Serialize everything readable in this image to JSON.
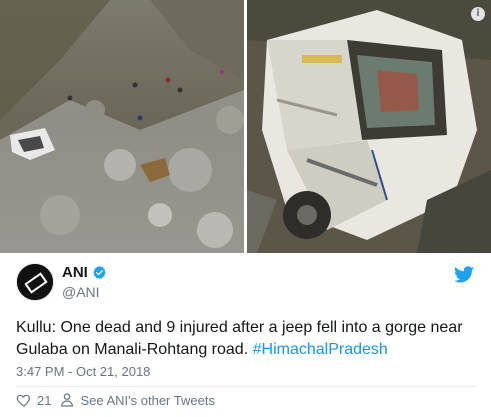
{
  "tweet": {
    "author": {
      "display_name": "ANI",
      "handle": "@ANI",
      "avatar_text": "ANI",
      "verified_icon": "verified-badge-icon"
    },
    "text_main": "Kullu: One dead and 9 injured after a jeep fell into a gorge near Gulaba on Manali-Rohtang road.",
    "hashtag": "#HimachalPradesh",
    "timestamp": "3:47 PM - Oct 21, 2018",
    "likes_count": "21",
    "see_others_label": "See ANI's other Tweets",
    "info_label": "i"
  },
  "colors": {
    "link": "#1b95e0",
    "twitter_blue": "#1da1f2",
    "secondary_text": "#657786",
    "like_red": "#e0245e"
  }
}
